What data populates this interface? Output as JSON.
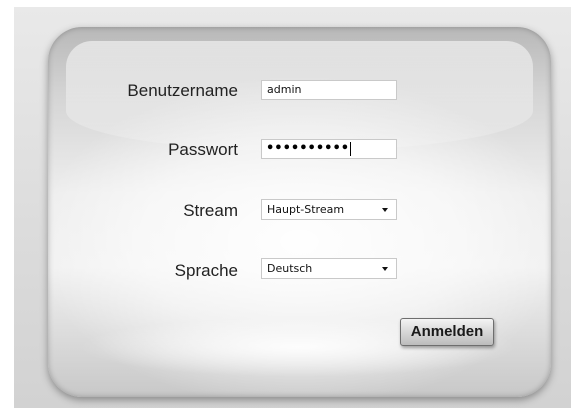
{
  "login_form": {
    "username": {
      "label": "Benutzername",
      "value": "admin"
    },
    "password": {
      "label": "Passwort",
      "masked_value": "••••••••••"
    },
    "stream": {
      "label": "Stream",
      "selected": "Haupt-Stream"
    },
    "language": {
      "label": "Sprache",
      "selected": "Deutsch"
    },
    "submit_label": "Anmelden"
  }
}
